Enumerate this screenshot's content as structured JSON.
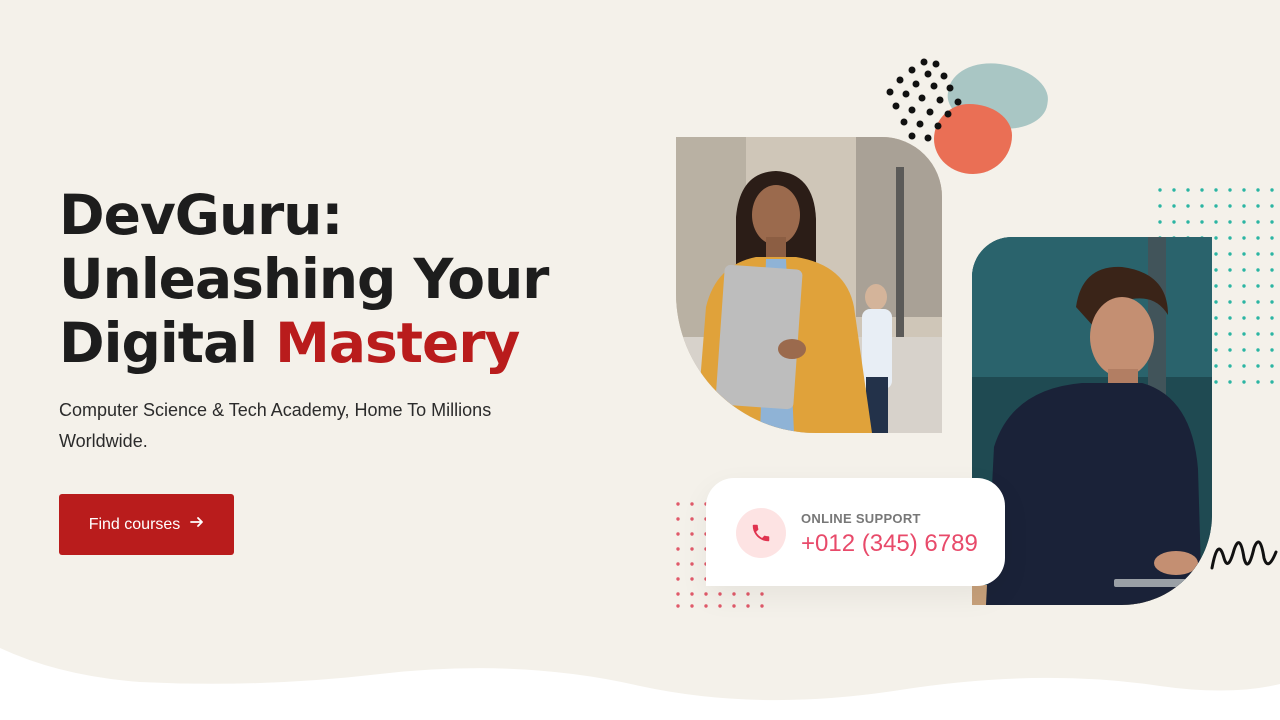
{
  "hero": {
    "title_line1": "DevGuru:",
    "title_line2": "Unleashing Your",
    "title_line3_prefix": "Digital ",
    "title_line3_accent": "Mastery",
    "subtitle": "Computer Science & Tech Academy, Home To Millions Worldwide.",
    "cta_label": "Find courses",
    "cta_icon": "arrow-right-icon"
  },
  "support": {
    "label": "ONLINE SUPPORT",
    "phone": "+012 (345) 6789",
    "icon": "phone-icon"
  },
  "colors": {
    "background": "#f4f1ea",
    "accent": "#b91c1c",
    "phone_text": "#e84a6a",
    "teal_blob": "#a9c6c4",
    "orange_blob": "#ea6f55",
    "dot_teal": "#2bb5a3"
  }
}
